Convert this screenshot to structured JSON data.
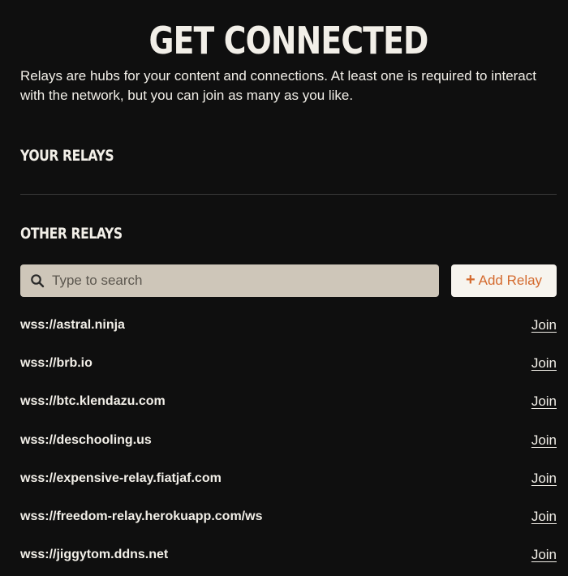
{
  "header": {
    "title": "GET CONNECTED",
    "intro": "Relays are hubs for your content and connections. At least one is required to interact with the network, but you can join as many as you like."
  },
  "your_relays": {
    "heading": "YOUR RELAYS"
  },
  "other_relays": {
    "heading": "OTHER RELAYS",
    "search": {
      "placeholder": "Type to search",
      "value": "",
      "icon": "search-icon"
    },
    "add_button": {
      "icon": "plus-icon",
      "icon_glyph": "+",
      "label": "Add Relay"
    },
    "relays": [
      {
        "url": "wss://astral.ninja",
        "action": "Join"
      },
      {
        "url": "wss://brb.io",
        "action": "Join"
      },
      {
        "url": "wss://btc.klendazu.com",
        "action": "Join"
      },
      {
        "url": "wss://deschooling.us",
        "action": "Join"
      },
      {
        "url": "wss://expensive-relay.fiatjaf.com",
        "action": "Join"
      },
      {
        "url": "wss://freedom-relay.herokuapp.com/ws",
        "action": "Join"
      },
      {
        "url": "wss://jiggytom.ddns.net",
        "action": "Join"
      }
    ]
  },
  "colors": {
    "background": "#0f0f0f",
    "text": "#f2efe8",
    "search_background": "#cec6b9",
    "button_background": "#f7f4ee",
    "accent": "#d46a2e",
    "divider": "#3a3a3a"
  }
}
